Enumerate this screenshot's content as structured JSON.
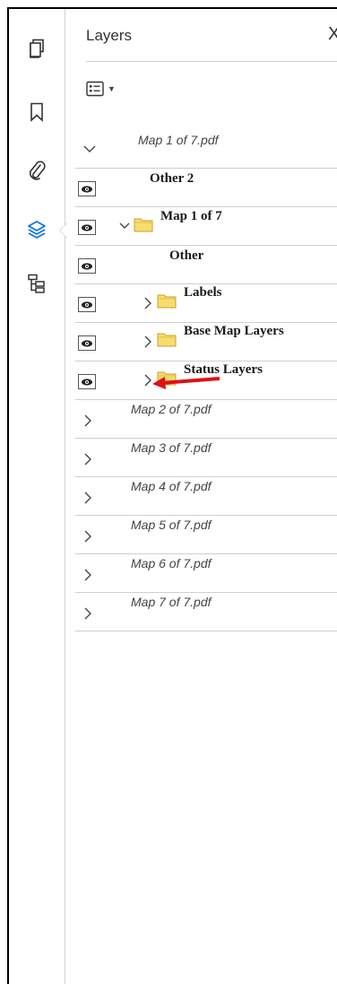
{
  "panel": {
    "title": "Layers",
    "close_glyph": "X"
  },
  "rail": {
    "icons": [
      "pages-icon",
      "bookmark-icon",
      "attachment-icon",
      "layers-icon",
      "structure-icon"
    ],
    "active": "layers-icon",
    "accent_color": "#1473e6"
  },
  "tree": {
    "map1_pdf": "Map 1 of 7.pdf",
    "other2": "Other 2",
    "map1_group": "Map 1 of 7",
    "other": "Other",
    "labels": "Labels",
    "base_map_layers": "Base Map Layers",
    "status_layers": "Status Layers",
    "collapsed_pdfs": [
      "Map 2 of 7.pdf",
      "Map 3 of 7.pdf",
      "Map 4 of 7.pdf",
      "Map 5 of 7.pdf",
      "Map 6 of 7.pdf",
      "Map 7 of 7.pdf"
    ]
  },
  "annotation": {
    "arrow_color": "#e01010"
  }
}
